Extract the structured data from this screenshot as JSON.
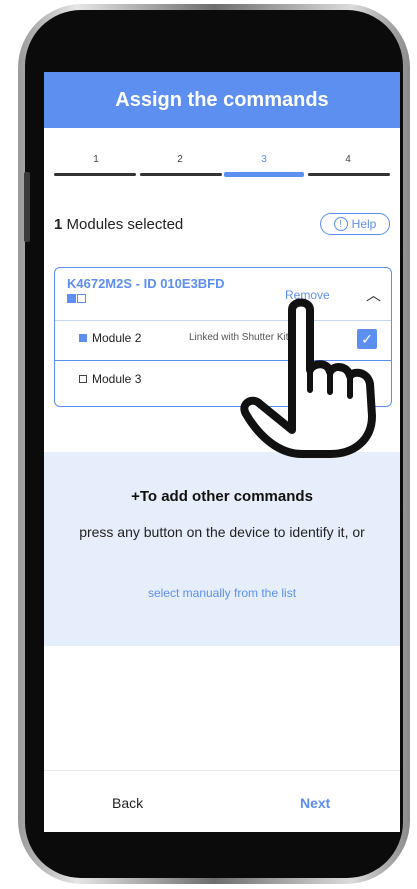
{
  "header": {
    "title": "Assign the commands"
  },
  "stepper": {
    "steps": [
      "1",
      "2",
      "3",
      "4"
    ],
    "active_index": 2
  },
  "selection": {
    "count": "1",
    "label": "Modules selected",
    "help_label": "Help",
    "help_icon": "info-circle-icon"
  },
  "device": {
    "title": "K4672M2S - ID 010E3BFD",
    "remove_label": "Remove",
    "modules": [
      {
        "name": "Module 2",
        "status": "Linked with Shutter Kitchen",
        "checked": true
      },
      {
        "name": "Module 3",
        "status": "",
        "checked": false
      }
    ]
  },
  "add_commands": {
    "title": "+To add other commands",
    "description": "press any button on the device to identify it, or",
    "link": "select manually from the list"
  },
  "footer": {
    "back_label": "Back",
    "next_label": "Next"
  },
  "colors": {
    "accent": "#5d8ff0",
    "panel": "#e7eefb"
  }
}
